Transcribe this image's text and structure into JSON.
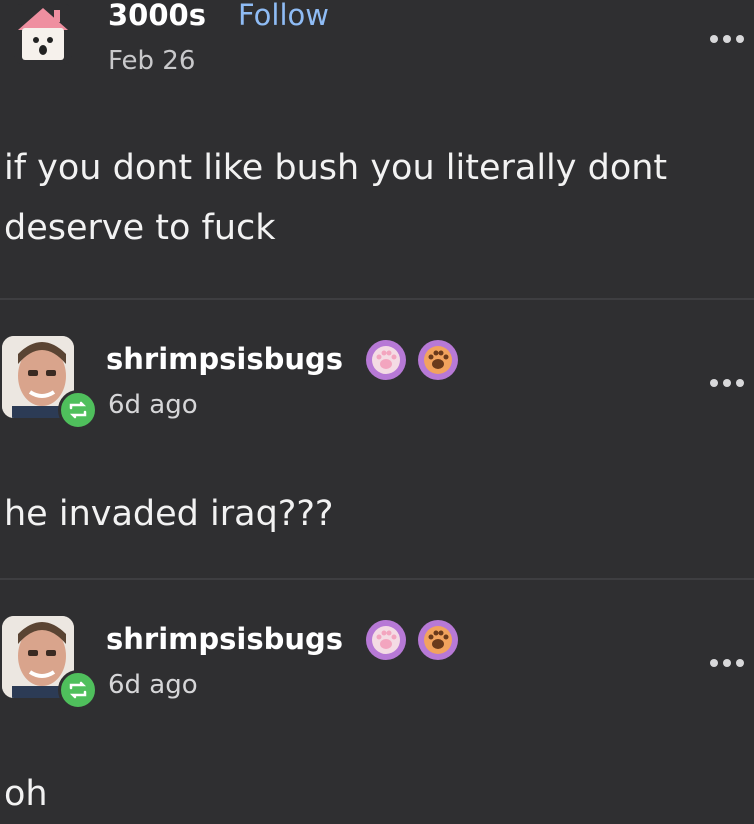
{
  "post": {
    "username": "3000s",
    "follow_label": "Follow",
    "date": "Feb 26",
    "text_line1": "if you dont like bush you literally dont",
    "text_line2": "deserve to fuck",
    "avatar_icon": "house-avatar-icon"
  },
  "replies": [
    {
      "username": "shrimpsisbugs",
      "time": "6d ago",
      "text": "he invaded iraq???",
      "badges": [
        "paw-badge-pink-icon",
        "paw-badge-orange-icon"
      ]
    },
    {
      "username": "shrimpsisbugs",
      "time": "6d ago",
      "text": "oh",
      "badges": [
        "paw-badge-pink-icon",
        "paw-badge-orange-icon"
      ]
    }
  ],
  "colors": {
    "background": "#2f2f31",
    "follow": "#8fbcf5",
    "reblog_badge": "#4fbf5c",
    "badge_purple": "#b779d6",
    "badge_orange": "#e9995a"
  }
}
